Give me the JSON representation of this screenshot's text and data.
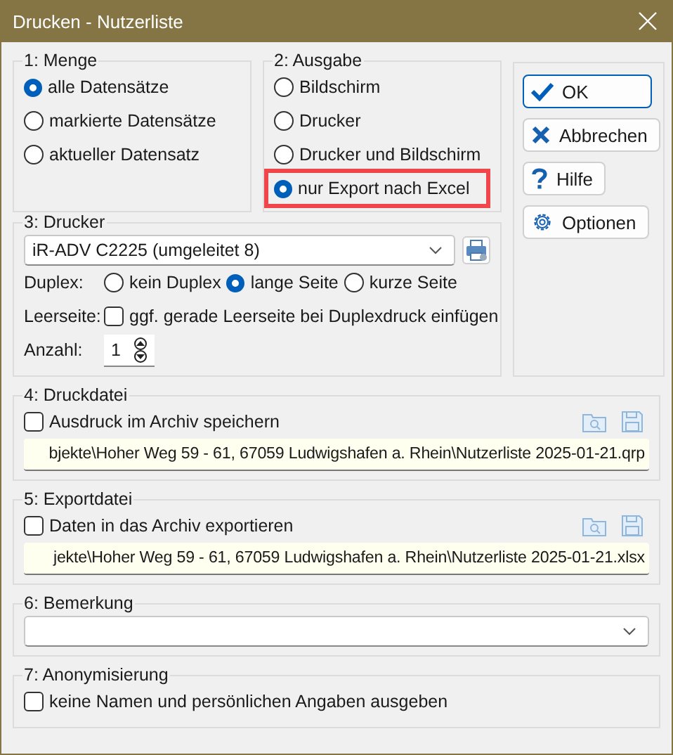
{
  "window": {
    "title": "Drucken - Nutzerliste"
  },
  "menge": {
    "title": "1: Menge",
    "options": [
      {
        "label": "alle Datensätze",
        "selected": true
      },
      {
        "label": "markierte Datensätze",
        "selected": false
      },
      {
        "label": "aktueller Datensatz",
        "selected": false
      }
    ]
  },
  "ausgabe": {
    "title": "2: Ausgabe",
    "options": [
      {
        "label": "Bildschirm",
        "selected": false,
        "highlighted": false
      },
      {
        "label": "Drucker",
        "selected": false,
        "highlighted": false
      },
      {
        "label": "Drucker und Bildschirm",
        "selected": false,
        "highlighted": false
      },
      {
        "label": "nur Export nach Excel",
        "selected": true,
        "highlighted": true
      }
    ]
  },
  "buttons": [
    {
      "label": "OK",
      "kind": "ok",
      "default": true
    },
    {
      "label": "Abbrechen",
      "kind": "cancel",
      "default": false
    },
    {
      "label": "Hilfe",
      "kind": "help",
      "default": false
    },
    {
      "label": "Optionen",
      "kind": "options",
      "default": false
    }
  ],
  "drucker": {
    "title": "3: Drucker",
    "printer": "iR-ADV C2225 (umgeleitet 8)",
    "duplex_label": "Duplex:",
    "duplex_options": [
      {
        "label": "kein Duplex",
        "selected": false
      },
      {
        "label": "lange Seite",
        "selected": true
      },
      {
        "label": "kurze Seite",
        "selected": false
      }
    ],
    "blank_label": "Leerseite:",
    "blank_option": {
      "label": "ggf. gerade Leerseite bei Duplexdruck einfügen",
      "checked": false
    },
    "count_label": "Anzahl:",
    "count": "1"
  },
  "druckdatei": {
    "title": "4: Druckdatei",
    "option": {
      "label": "Ausdruck im Archiv speichern",
      "checked": false
    },
    "path": "bjekte\\Hoher Weg 59 - 61, 67059 Ludwigshafen a. Rhein\\Nutzerliste 2025-01-21.qrp"
  },
  "exportdatei": {
    "title": "5: Exportdatei",
    "option": {
      "label": "Daten in das Archiv exportieren",
      "checked": false
    },
    "path": "jekte\\Hoher Weg 59 - 61, 67059 Ludwigshafen a. Rhein\\Nutzerliste 2025-01-21.xlsx"
  },
  "bemerkung": {
    "title": "6: Bemerkung"
  },
  "anonymisierung": {
    "title": "7: Anonymisierung",
    "option": {
      "label": "keine Namen und persönlichen Angaben ausgeben",
      "checked": false
    }
  }
}
